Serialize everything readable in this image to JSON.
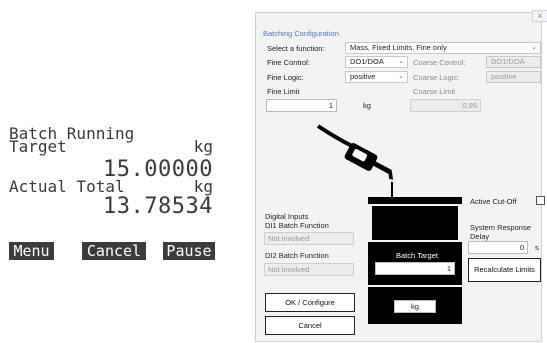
{
  "lcd": {
    "line1": "Batch Running",
    "target_label": "Target",
    "target_unit": "kg",
    "target_value": "15.00000",
    "actual_label": "Actual Total",
    "actual_unit": "kg",
    "actual_value": "13.78534",
    "softkeys": [
      "Menu",
      "Cancel",
      "Pause"
    ]
  },
  "window": {
    "close_glyph": "×",
    "section_title": "Batching Configuration",
    "function_label": "Select a function:",
    "function_value": "Mass, Fixed Limits, Fine only",
    "fine_control_label": "Fine Control:",
    "fine_control_value": "DO1/DOA",
    "coarse_control_label": "Coarse Control:",
    "coarse_control_value": "DO1/DOA",
    "fine_logic_label": "Fine Logic:",
    "fine_logic_value": "positive",
    "coarse_logic_label": "Coarse Logic:",
    "coarse_logic_value": "positive",
    "fine_limit_label": "Fine Limit",
    "fine_limit_value": "1",
    "fine_limit_unit": "kg",
    "coarse_limit_label": "Coarse Limit",
    "coarse_limit_value": "0,95",
    "active_cutoff_label": "Active Cut-Off",
    "system_response_label_1": "System Response",
    "system_response_label_2": "Delay",
    "system_response_value": "0",
    "system_response_unit": "s",
    "digital_inputs_label": "Digital Inputs",
    "di1_label": "DI1 Batch Function",
    "di1_value": "Not involved",
    "di2_label": "DI2 Batch Function",
    "di2_value": "Not involved",
    "batch_target_label": "Batch Target",
    "batch_target_value": "1",
    "unit_value": "kg",
    "recalculate_button": "Recalculate Limits",
    "ok_button": "OK / Configure",
    "cancel_button": "Cancel"
  }
}
